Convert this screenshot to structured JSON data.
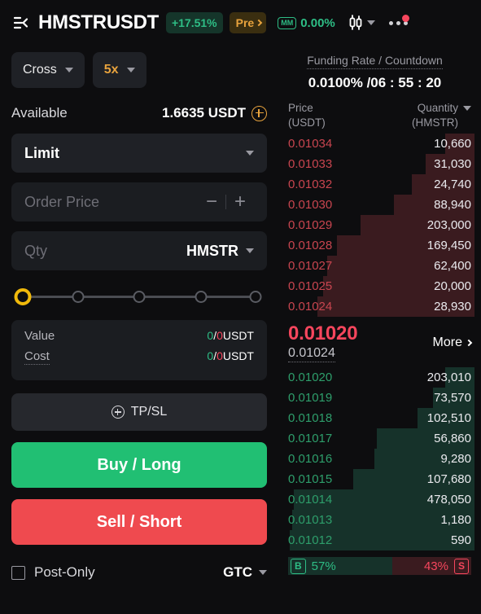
{
  "header": {
    "menu_icon": "list-menu-icon",
    "symbol": "HMSTRUSDT",
    "change_badge": "+17.51%",
    "pre_badge": "Pre",
    "mm_tag": "MM",
    "mm_percent": "0.00%",
    "candle_icon": "candlestick-chart-icon",
    "more_icon": "more-options-icon"
  },
  "order_form": {
    "margin_mode": "Cross",
    "leverage": "5x",
    "available_label": "Available",
    "available_value": "1.6635 USDT",
    "add_funds_icon": "plus-circle-icon",
    "order_type": "Limit",
    "price_placeholder": "Order Price",
    "minus_label": "−",
    "plus_label": "+",
    "qty_placeholder": "Qty",
    "qty_unit": "HMSTR",
    "slider_percent": 0,
    "slider_nodes": [
      "0",
      "25",
      "50",
      "75",
      "100"
    ],
    "value_label": "Value",
    "value_amount_a": "0",
    "value_sep": "/",
    "value_amount_b": "0",
    "value_unit": "USDT",
    "cost_label": "Cost",
    "cost_amount_a": "0",
    "cost_sep": "/",
    "cost_amount_b": "0",
    "cost_unit": "USDT",
    "tpsl_label": "TP/SL",
    "buy_label": "Buy / Long",
    "sell_label": "Sell / Short",
    "post_only_label": "Post-Only",
    "post_only_checked": false,
    "time_in_force": "GTC"
  },
  "order_book": {
    "funding_label": "Funding Rate / Countdown",
    "funding_value": "0.0100% /06 : 55 : 20",
    "col_price": "Price",
    "col_price_unit": "(USDT)",
    "col_qty": "Quantity",
    "col_qty_unit": "(HMSTR)",
    "asks": [
      {
        "price": "0.01034",
        "qty": "10,660",
        "depth": 15
      },
      {
        "price": "0.01033",
        "qty": "31,030",
        "depth": 25
      },
      {
        "price": "0.01032",
        "qty": "24,740",
        "depth": 32
      },
      {
        "price": "0.01030",
        "qty": "88,940",
        "depth": 41
      },
      {
        "price": "0.01029",
        "qty": "203,000",
        "depth": 58
      },
      {
        "price": "0.01028",
        "qty": "169,450",
        "depth": 70
      },
      {
        "price": "0.01027",
        "qty": "62,400",
        "depth": 75
      },
      {
        "price": "0.01025",
        "qty": "20,000",
        "depth": 77
      },
      {
        "price": "0.01024",
        "qty": "28,930",
        "depth": 80
      }
    ],
    "mid_price": "0.01020",
    "mark_price": "0.01024",
    "more_label": "More",
    "bids": [
      {
        "price": "0.01020",
        "qty": "203,010",
        "depth": 15
      },
      {
        "price": "0.01019",
        "qty": "73,570",
        "depth": 21
      },
      {
        "price": "0.01018",
        "qty": "102,510",
        "depth": 29
      },
      {
        "price": "0.01017",
        "qty": "56,860",
        "depth": 50
      },
      {
        "price": "0.01016",
        "qty": "9,280",
        "depth": 51
      },
      {
        "price": "0.01015",
        "qty": "107,680",
        "depth": 62
      },
      {
        "price": "0.01014",
        "qty": "478,050",
        "depth": 92
      },
      {
        "price": "0.01013",
        "qty": "1,180",
        "depth": 93
      },
      {
        "price": "0.01012",
        "qty": "590",
        "depth": 94
      }
    ],
    "buy_tag": "B",
    "buy_ratio": "57%",
    "sell_ratio": "43%",
    "sell_tag": "S",
    "buy_ratio_pct": 57
  },
  "colors": {
    "green": "#2ebd85",
    "red": "#f6465d",
    "accent": "#e8a33d",
    "buy_button": "#21bf73",
    "sell_button": "#ef4a4f",
    "ask_depth": "#3a1b1f",
    "bid_depth": "#16322a"
  }
}
